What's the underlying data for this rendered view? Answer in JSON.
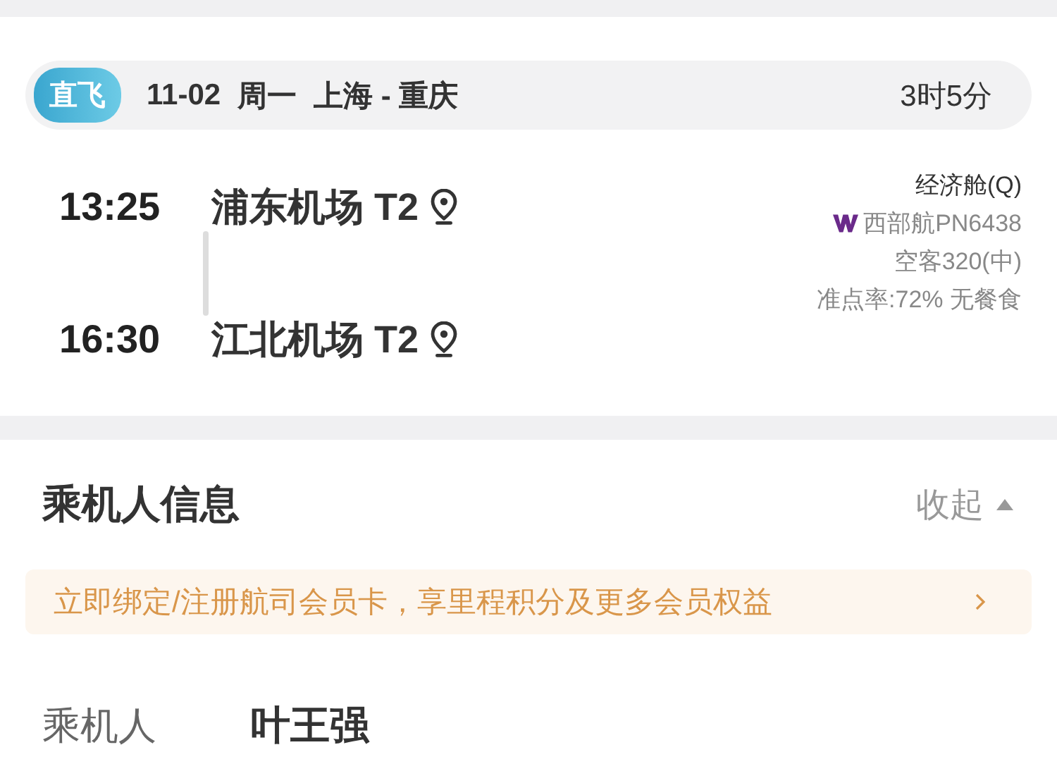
{
  "flight": {
    "badge": "直飞",
    "date": "11-02",
    "weekday": "周一",
    "route": "上海 - 重庆",
    "duration": "3时5分",
    "departure": {
      "time": "13:25",
      "airport": "浦东机场 T2"
    },
    "arrival": {
      "time": "16:30",
      "airport": "江北机场 T2"
    },
    "cabin": "经济舱(Q)",
    "airline": "西部航PN6438",
    "aircraft": "空客320(中)",
    "punctuality": "准点率:72% 无餐食"
  },
  "passenger_section": {
    "title": "乘机人信息",
    "toggle": "收起",
    "expanded": true,
    "banner": "立即绑定/注册航司会员卡，享里程积分及更多会员权益",
    "fields": [
      {
        "label": "乘机人",
        "value": "叶王强"
      }
    ]
  }
}
